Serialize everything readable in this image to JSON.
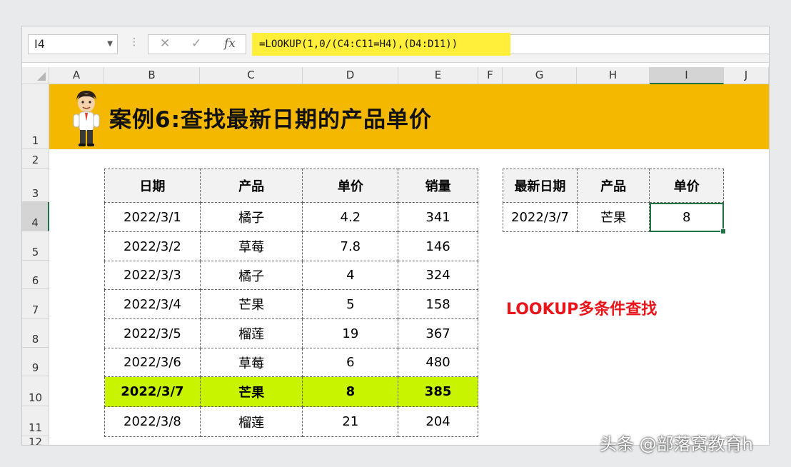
{
  "formula_bar": {
    "name_box": "I4",
    "cancel": "✕",
    "enter": "✓",
    "fx": "fx",
    "formula": "=LOOKUP(1,0/(C4:C11=H4),(D4:D11))"
  },
  "columns": [
    "A",
    "B",
    "C",
    "D",
    "E",
    "F",
    "G",
    "H",
    "I",
    "J"
  ],
  "rows": [
    "1",
    "2",
    "3",
    "4",
    "5",
    "6",
    "7",
    "8",
    "9",
    "10",
    "11",
    "12"
  ],
  "banner": {
    "title": "案例6:查找最新日期的产品单价",
    "color": "#f5b800"
  },
  "main_table": {
    "headers": [
      "日期",
      "产品",
      "单价",
      "销量"
    ],
    "rows": [
      [
        "2022/3/1",
        "橘子",
        "4.2",
        "341"
      ],
      [
        "2022/3/2",
        "草莓",
        "7.8",
        "146"
      ],
      [
        "2022/3/3",
        "橘子",
        "4",
        "324"
      ],
      [
        "2022/3/4",
        "芒果",
        "5",
        "158"
      ],
      [
        "2022/3/5",
        "榴莲",
        "19",
        "367"
      ],
      [
        "2022/3/6",
        "草莓",
        "6",
        "480"
      ],
      [
        "2022/3/7",
        "芒果",
        "8",
        "385"
      ],
      [
        "2022/3/8",
        "榴莲",
        "21",
        "204"
      ]
    ],
    "highlight_color": "#c9f400"
  },
  "lookup_table": {
    "headers": [
      "最新日期",
      "产品",
      "单价"
    ],
    "row": [
      "2022/3/7",
      "芒果",
      "8"
    ]
  },
  "note": "LOOKUP多条件查找",
  "watermark": "头条 @部落窝教育h"
}
